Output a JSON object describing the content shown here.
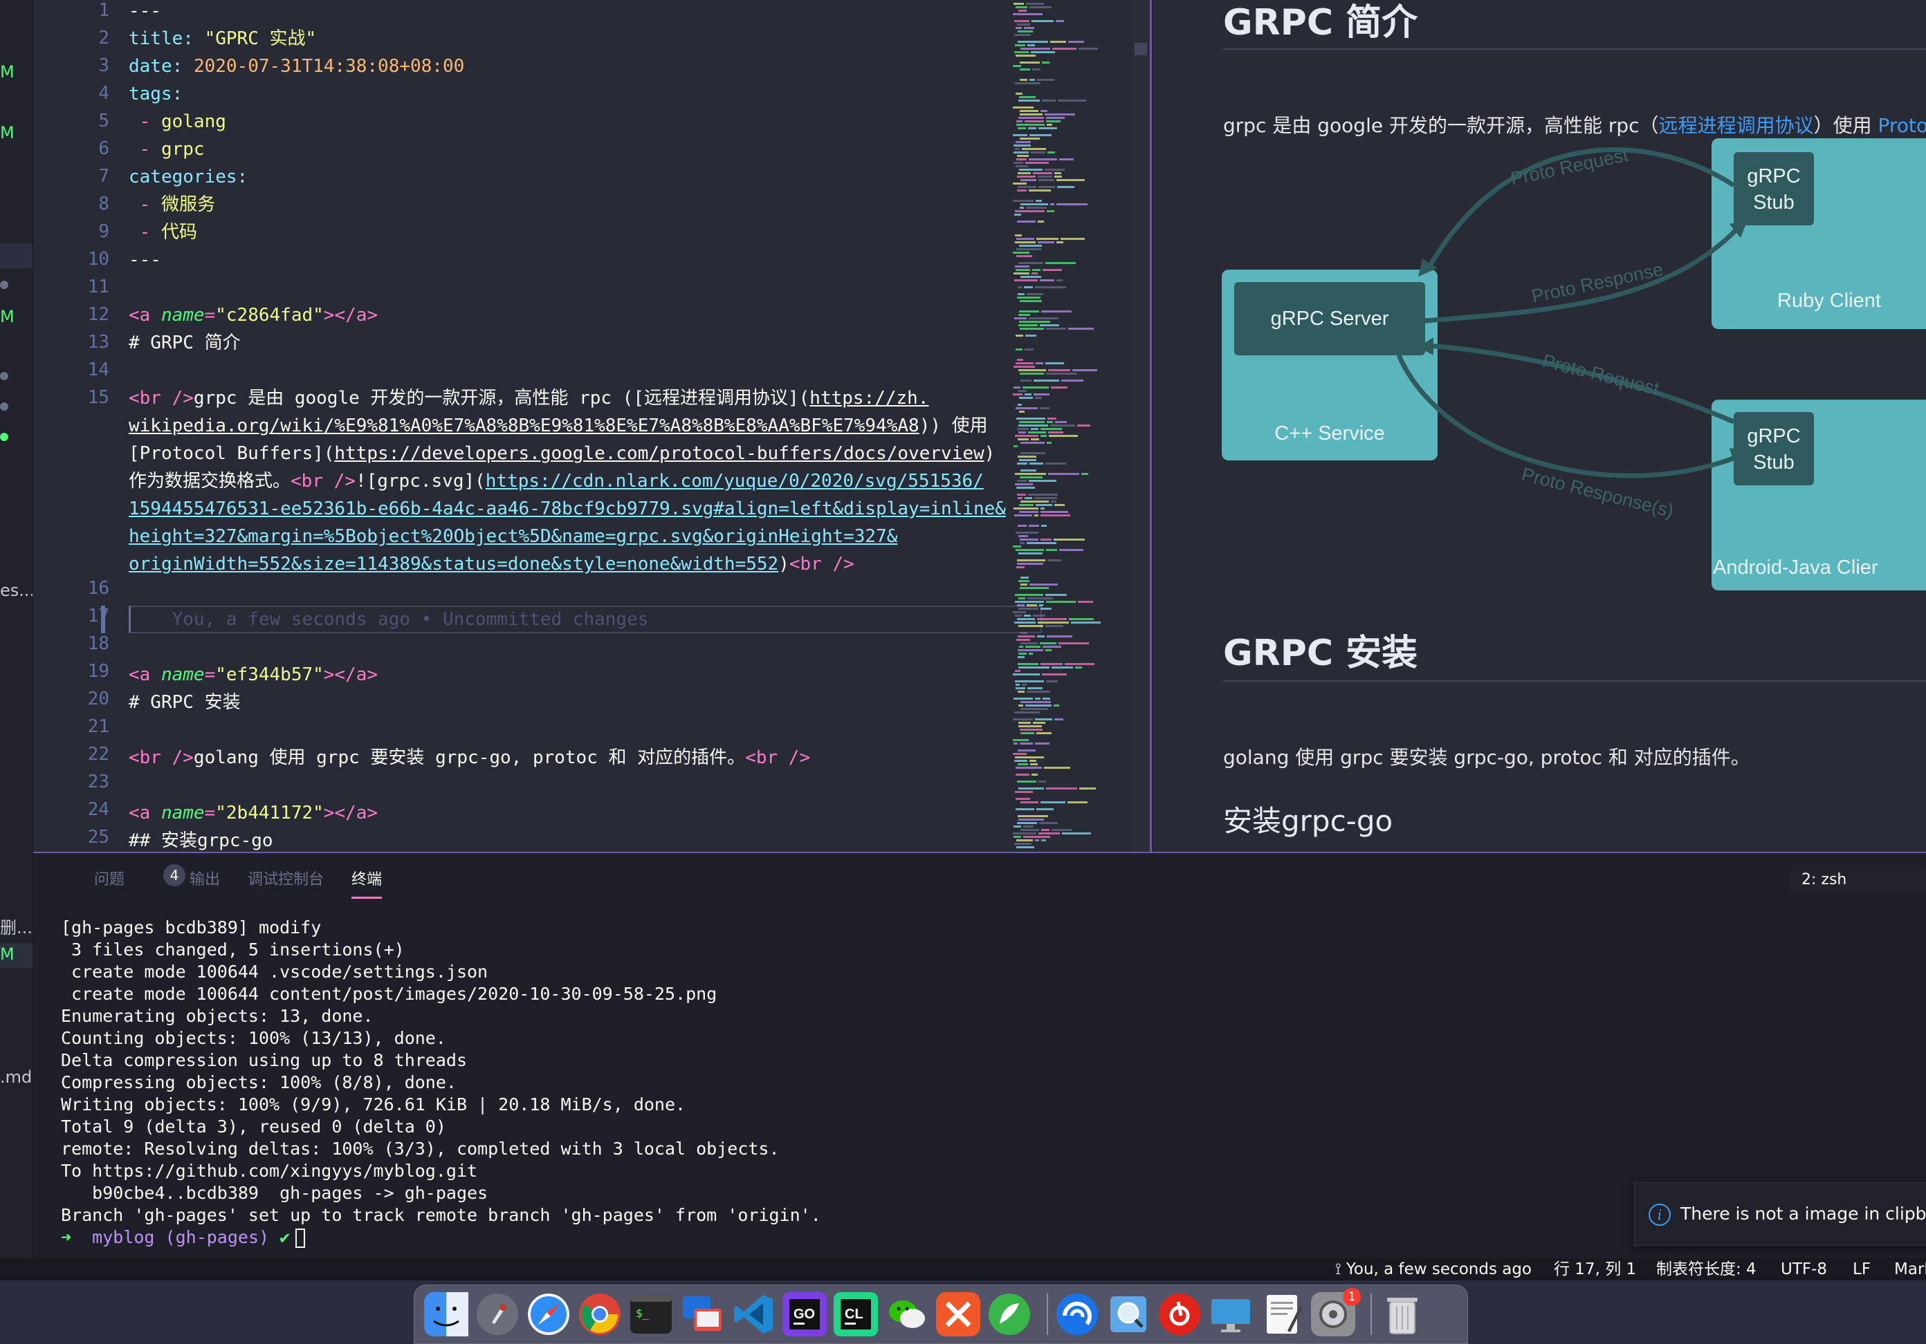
{
  "sidebar": {
    "fragments": [
      "M",
      "M",
      "M",
      "es...",
      "删...",
      "M",
      ".md"
    ]
  },
  "editor": {
    "line_numbers": [
      "1",
      "2",
      "3",
      "4",
      "5",
      "6",
      "7",
      "8",
      "9",
      "10",
      "11",
      "12",
      "13",
      "14",
      "15",
      "16",
      "17",
      "18",
      "19",
      "20",
      "21",
      "22",
      "23",
      "24",
      "25"
    ],
    "front_matter": {
      "delim": "---",
      "title_key": "title:",
      "title_val": "\"GPRC 实战\"",
      "date_key": "date:",
      "date_val": "2020-07-31T14:38:08+08:00",
      "tags_key": "tags:",
      "tags": [
        "golang",
        "grpc"
      ],
      "categories_key": "categories:",
      "categories": [
        "微服务",
        "代码"
      ],
      "dash": "-"
    },
    "anchors": [
      {
        "tag_open": "<a",
        "attr": "name",
        "value": "\"c2864fad\"",
        "tag_close": "></a>"
      },
      {
        "tag_open": "<a",
        "attr": "name",
        "value": "\"ef344b57\"",
        "tag_close": "></a>"
      },
      {
        "tag_open": "<a",
        "attr": "name",
        "value": "\"2b441172\"",
        "tag_close": "></a>"
      }
    ],
    "heading_intro": "# GRPC 简介",
    "heading_install": "# GRPC 安装",
    "heading_grpcgo": "## 安装grpc-go",
    "br_tag": "<br />",
    "line15_a_text": "grpc 是由 google 开发的一款开源，高性能 rpc ([远程进程调用协议](",
    "line15_a_url": "https://zh.",
    "line15_b_url": "wikipedia.org/wiki/%E9%81%A0%E7%A8%8B%E9%81%8E%E7%A8%8B%E8%AA%BF%E7%94%A8",
    "line15_b_text": ")) 使用",
    "line15_c_text1": "[Protocol Buffers](",
    "line15_c_url": "https://developers.google.com/protocol-buffers/docs/overview",
    "line15_c_text2": ")",
    "line15_d_text": "作为数据交换格式。",
    "line15_d_text2": "![grpc.svg](",
    "line15_d_url": "https://cdn.nlark.com/yuque/0/2020/svg/551536/",
    "line15_e_url": "1594455476531-ee52361b-e66b-4a4c-aa46-78bcf9cb9779.svg#align=left&display=inline&",
    "line15_f_url": "height=327&margin=%5Bobject%20Object%5D&name=grpc.svg&originHeight=327&",
    "line15_g_url": "originWidth=552&size=114389&status=done&style=none&width=552",
    "line15_g_text": ")",
    "ghost_text": "You, a few seconds ago • Uncommitted changes",
    "line22_text": "golang 使用 grpc 要安装 grpc-go, protoc 和 对应的插件。"
  },
  "preview": {
    "h1_intro": "GRPC 简介",
    "intro_p1": "grpc 是由 google 开发的一款开源，高性能 rpc（",
    "intro_link1": "远程进程调用协议",
    "intro_p2": "）使用 ",
    "intro_link2": "Protocol",
    "h1_install": "GRPC 安装",
    "install_p": "golang 使用 grpc 要安装 grpc-go, protoc 和 对应的插件。",
    "h2_grpcgo": "安装grpc-go",
    "diagram": {
      "server_label": "gRPC Server",
      "service_label": "C++ Service",
      "stub_label_1": "gRPC",
      "stub_label_2": "Stub",
      "ruby_label": "Ruby Client",
      "android_label": "Android-Java Clier",
      "edge_labels": [
        "Proto Request",
        "Proto Response",
        "Proto Request",
        "Proto Response(s)"
      ],
      "box_color": "#5bb5bc",
      "dark_box_color": "#2f5a5e"
    }
  },
  "panel": {
    "tabs": [
      "问题",
      "输出",
      "调试控制台",
      "终端"
    ],
    "problems_count": "4",
    "terminal_selector": "2: zsh",
    "terminal_lines": [
      "[gh-pages bcdb389] modify",
      " 3 files changed, 5 insertions(+)",
      " create mode 100644 .vscode/settings.json",
      " create mode 100644 content/post/images/2020-10-30-09-58-25.png",
      "Enumerating objects: 13, done.",
      "Counting objects: 100% (13/13), done.",
      "Delta compression using up to 8 threads",
      "Compressing objects: 100% (8/8), done.",
      "Writing objects: 100% (9/9), 726.61 KiB | 20.18 MiB/s, done.",
      "Total 9 (delta 3), reused 0 (delta 0)",
      "remote: Resolving deltas: 100% (3/3), completed with 3 local objects.",
      "To https://github.com/xingyys/myblog.git",
      "   b90cbe4..bcdb389  gh-pages -> gh-pages",
      "Branch 'gh-pages' set up to track remote branch 'gh-pages' from 'origin'."
    ],
    "prompt": {
      "arrow": "➜",
      "dir": "myblog",
      "branch": "(gh-pages)",
      "check": "✔"
    }
  },
  "notification": {
    "text": "There is not a image in clipboar"
  },
  "statusbar": {
    "blame": "You, a few seconds ago",
    "position": "行 17, 列 1",
    "tab_size": "制表符长度: 4",
    "encoding": "UTF-8",
    "eol": "LF",
    "language": "Mark"
  },
  "dock": {
    "apps": [
      "finder",
      "launchpad",
      "safari",
      "chrome",
      "terminal",
      "remote-desktop",
      "vscode",
      "goland",
      "clion",
      "wechat",
      "xmind",
      "feishu",
      "edge-like",
      "preview",
      "netease-music",
      "screen",
      "textedit",
      "system-preferences",
      "trash"
    ],
    "system_preferences_badge": "1"
  }
}
